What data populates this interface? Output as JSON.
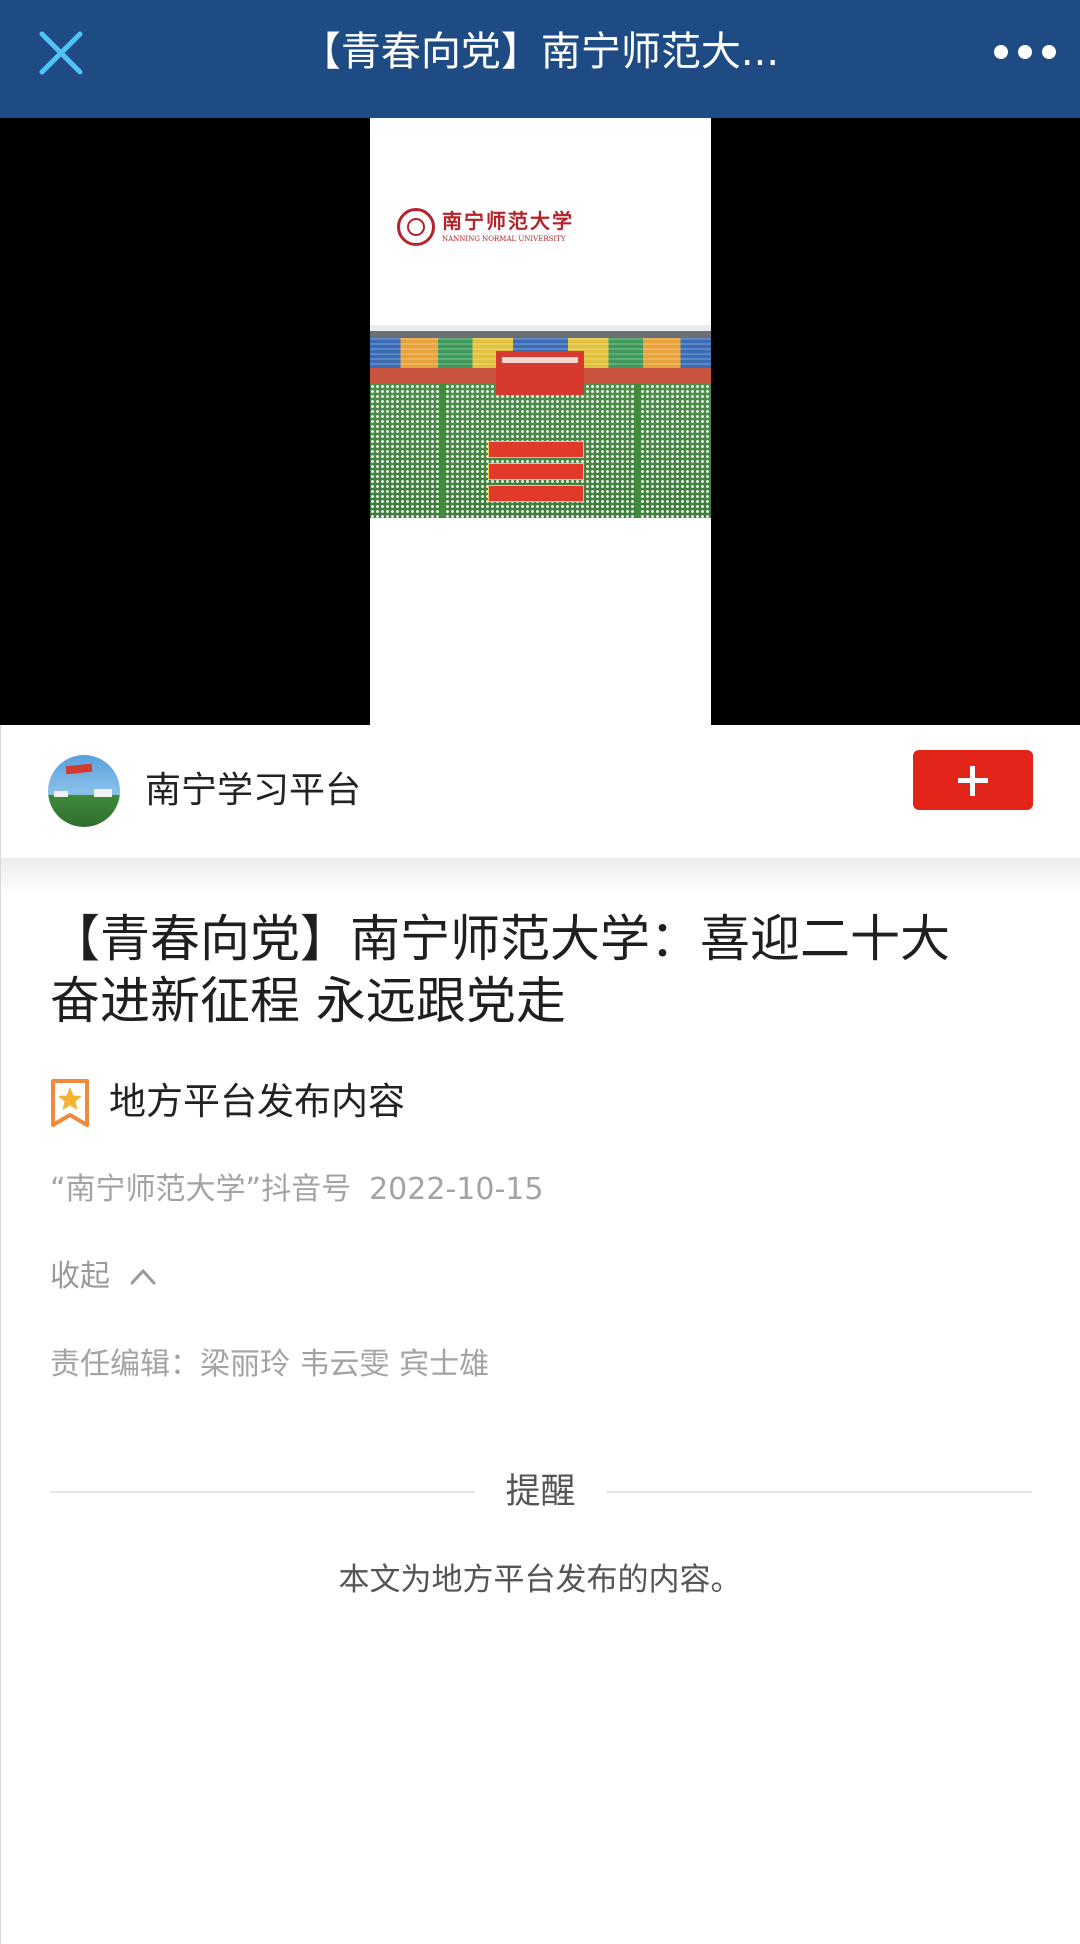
{
  "theme": {
    "header_color": "#1e4b83",
    "close_icon_color": "#4fc3f7",
    "accent_red": "#e3241b",
    "badge_orange": "#f08a3c"
  },
  "header": {
    "title": "【青春向党】南宁师范大...",
    "close_icon": "close-icon",
    "more_icon": "more-icon"
  },
  "video": {
    "logo_cn": "南宁师范大学",
    "logo_en": "NANNING NORMAL UNIVERSITY"
  },
  "author": {
    "name": "南宁学习平台",
    "avatar_icon": "avatar-image",
    "follow_icon": "plus-icon"
  },
  "article": {
    "title": "【青春向党】南宁师范大学：喜迎二十大 奋进新征程 永远跟党走",
    "badge_icon": "star-bookmark-icon",
    "badge_label": "地方平台发布内容",
    "source": "“南宁师范大学”抖音号",
    "date": "2022-10-15",
    "collapse_label": "收起",
    "collapse_icon": "chevron-up-icon",
    "editors": "责任编辑：梁丽玲 韦云雯 宾士雄"
  },
  "notice": {
    "heading": "提醒",
    "text": "本文为地方平台发布的内容。"
  }
}
